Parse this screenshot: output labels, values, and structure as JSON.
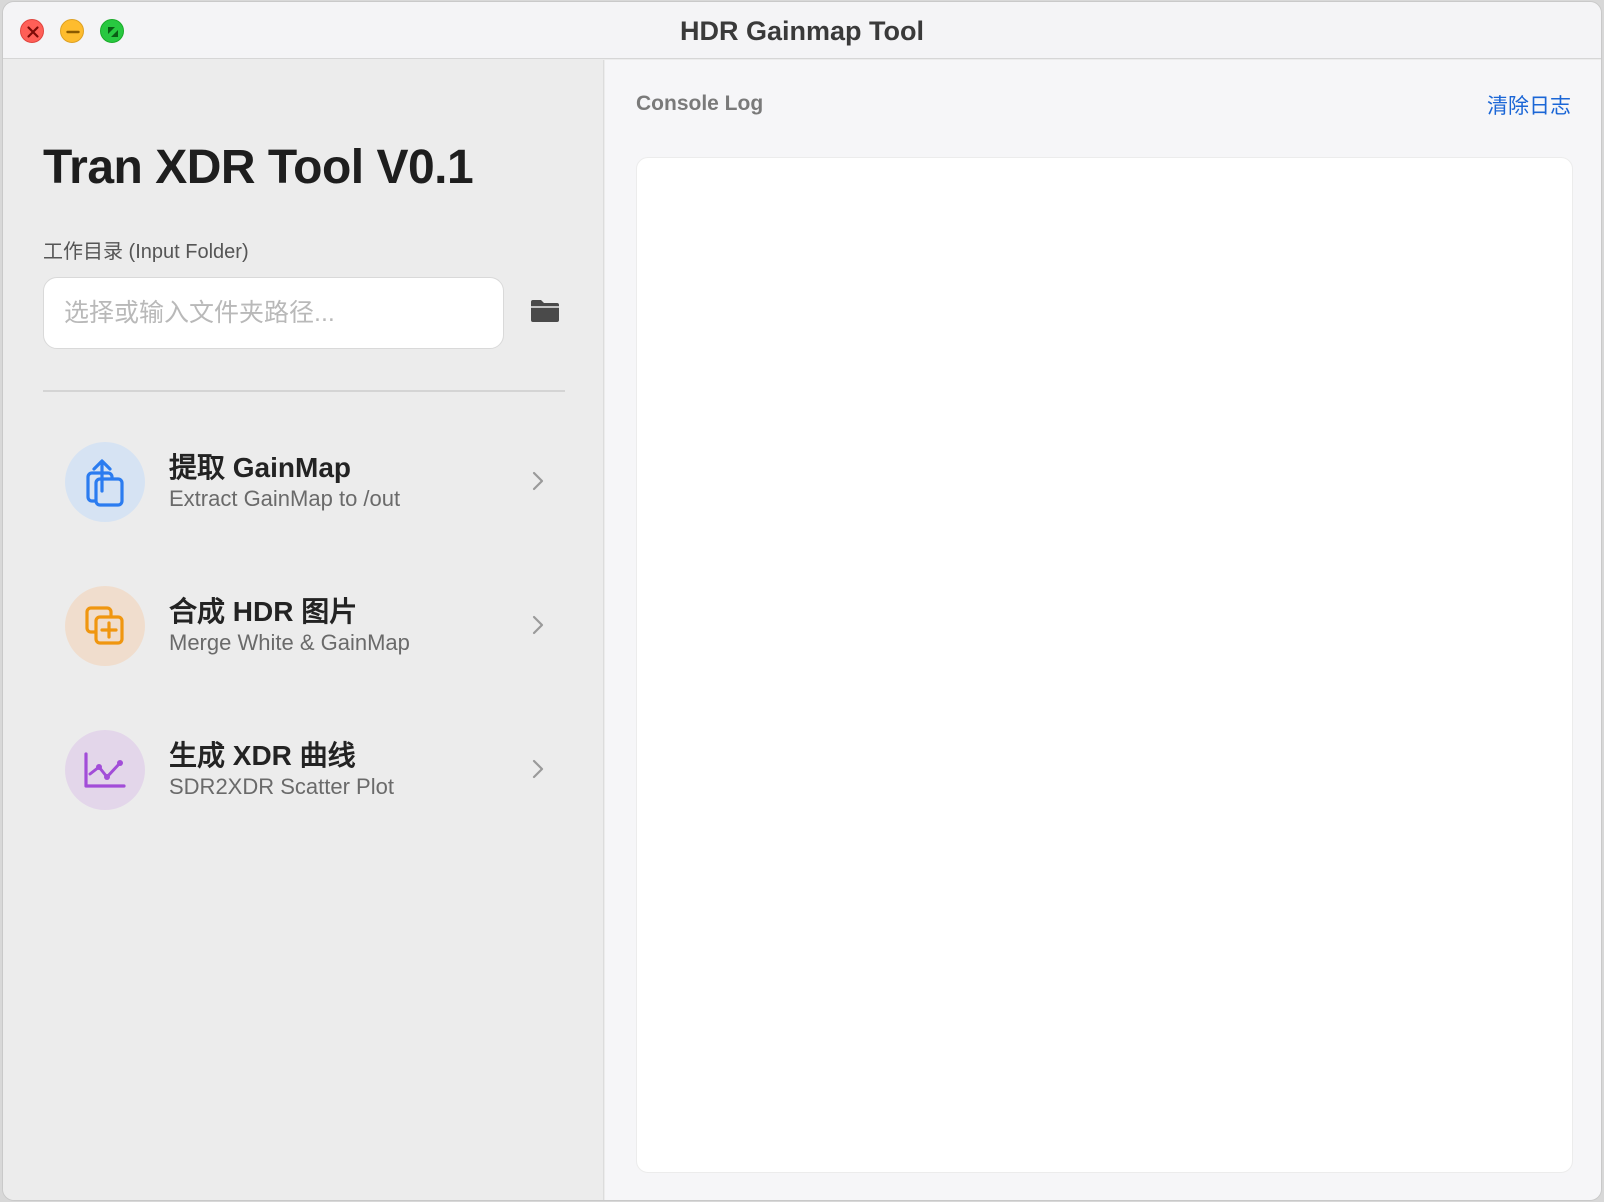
{
  "window": {
    "title": "HDR Gainmap Tool"
  },
  "sidebar": {
    "app_title": "Tran XDR Tool V0.1",
    "folder_label": "工作目录 (Input Folder)",
    "folder_input": {
      "value": "",
      "placeholder": "选择或输入文件夹路径..."
    },
    "folder_button_icon": "folder-icon",
    "actions": [
      {
        "title": "提取 GainMap",
        "subtitle": "Extract GainMap to /out",
        "icon": "share-upload-icon",
        "color": "#2b7cf0",
        "bg": "#d6e3f3"
      },
      {
        "title": "合成 HDR 图片",
        "subtitle": "Merge White & GainMap",
        "icon": "plus-square-stack-icon",
        "color": "#f0960f",
        "bg": "#f0ddcd"
      },
      {
        "title": "生成 XDR 曲线",
        "subtitle": "SDR2XDR Scatter Plot",
        "icon": "line-chart-icon",
        "color": "#a24dd8",
        "bg": "#e3d6ea"
      }
    ]
  },
  "console": {
    "label": "Console Log",
    "clear_label": "清除日志",
    "log_text": ""
  },
  "colors": {
    "accent": "#1b66d6",
    "close": "#ff5f57",
    "minimize": "#febc2e",
    "maximize": "#28c840"
  }
}
